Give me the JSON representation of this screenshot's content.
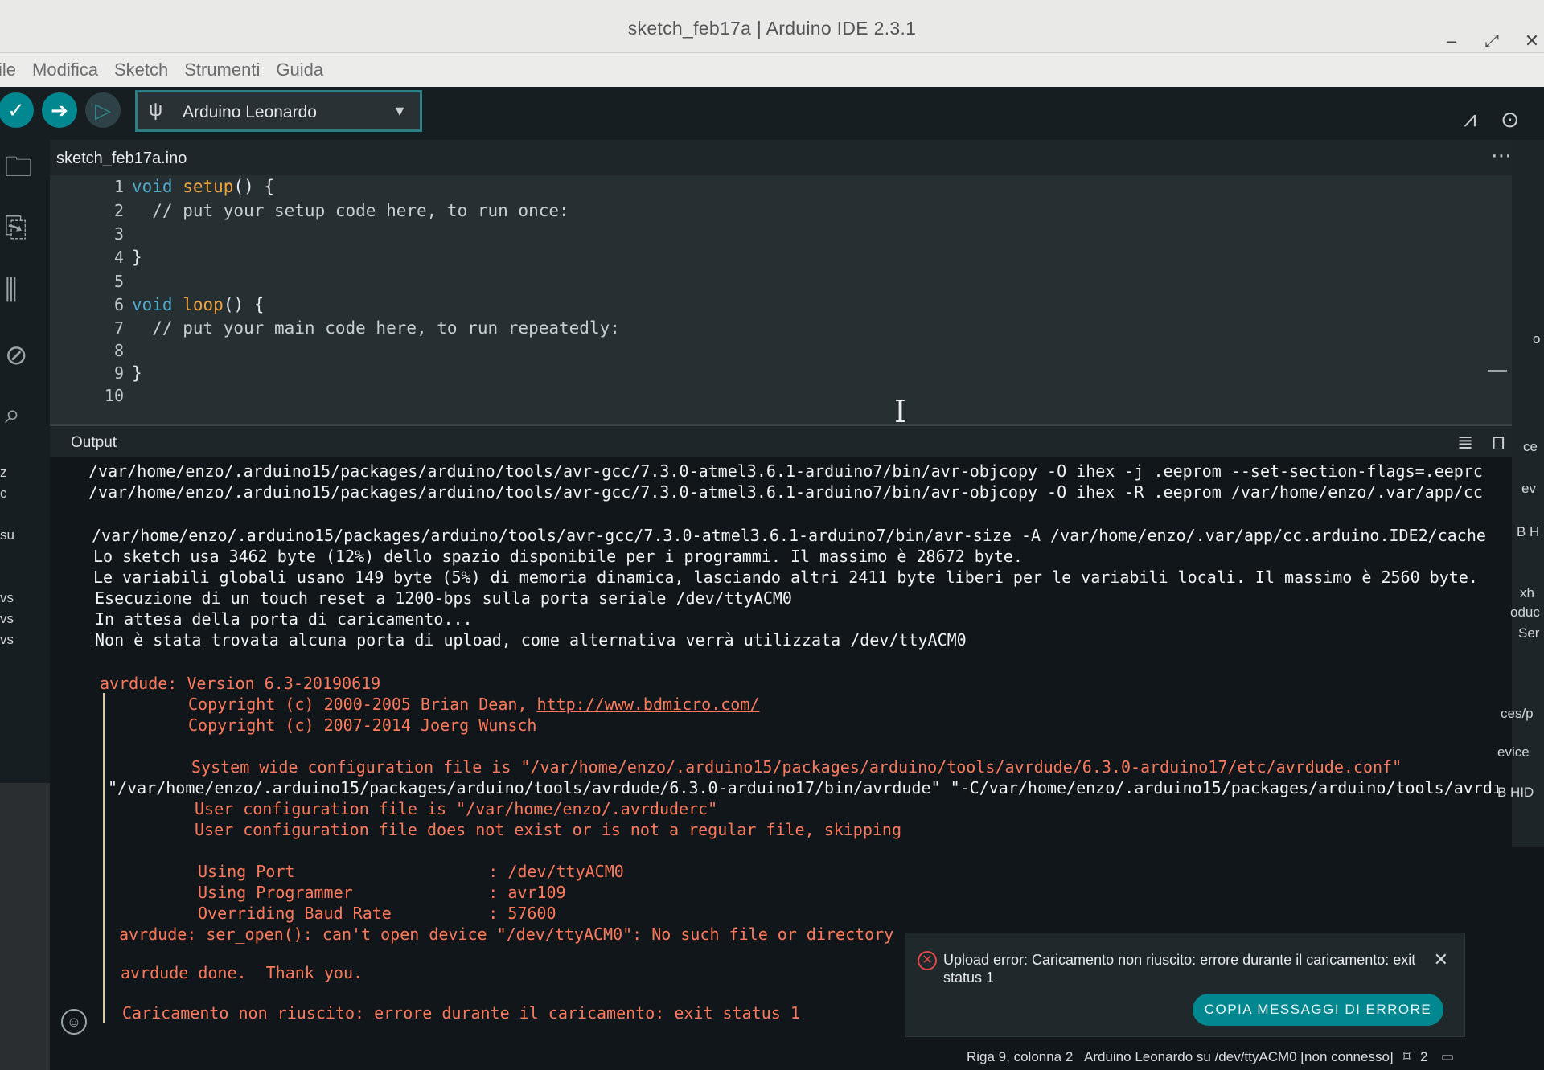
{
  "window": {
    "title": "sketch_feb17a | Arduino IDE 2.3.1",
    "controls": {
      "minimize": "–",
      "maximize": "⤢",
      "close": "✕"
    }
  },
  "menu": {
    "items": [
      "ile",
      "Modifica",
      "Sketch",
      "Strumenti",
      "Guida"
    ]
  },
  "toolbar": {
    "verify_icon": "check-icon",
    "upload_icon": "arrow-right-icon",
    "debug_icon": "debug-icon",
    "board": "Arduino Leonardo"
  },
  "editor": {
    "tab_name": "sketch_feb17a.ino",
    "line_numbers": [
      "1",
      "2",
      "3",
      "4",
      "5",
      "6",
      "7",
      "8",
      "9",
      "10"
    ],
    "lines": {
      "l1_kw": "void",
      "l1_fn": "setup",
      "l1_rest": "() {",
      "l2": "  // put your setup code here, to run once:",
      "l4": "}",
      "l6_kw": "void",
      "l6_fn": "loop",
      "l6_rest": "() {",
      "l7": "  // put your main code here, to run repeatedly:",
      "l9": "}"
    }
  },
  "output": {
    "header": "Output",
    "lines": [
      "/var/home/enzo/.arduino15/packages/arduino/tools/avr-gcc/7.3.0-atmel3.6.1-arduino7/bin/avr-objcopy -O ihex -j .eeprom --set-section-flags=.eeprc",
      "/var/home/enzo/.arduino15/packages/arduino/tools/avr-gcc/7.3.0-atmel3.6.1-arduino7/bin/avr-objcopy -O ihex -R .eeprom /var/home/enzo/.var/app/cc",
      "/var/home/enzo/.arduino15/packages/arduino/tools/avr-gcc/7.3.0-atmel3.6.1-arduino7/bin/avr-size -A /var/home/enzo/.var/app/cc.arduino.IDE2/cache",
      "Lo sketch usa 3462 byte (12%) dello spazio disponibile per i programmi. Il massimo è 28672 byte.",
      "Le variabili globali usano 149 byte (5%) di memoria dinamica, lasciando altri 2411 byte liberi per le variabili locali. Il massimo è 2560 byte.",
      "Esecuzione di un touch reset a 1200-bps sulla porta seriale /dev/ttyACM0",
      "In attesa della porta di caricamento...",
      "Non è stata trovata alcuna porta di upload, come alternativa verrà utilizzata /dev/ttyACM0"
    ],
    "avrdude": {
      "version": "avrdude: Version 6.3-20190619",
      "copy1_prefix": "Copyright (c) 2000-2005 Brian Dean, ",
      "copy1_link": "http://www.bdmicro.com/",
      "copy2": "Copyright (c) 2007-2014 Joerg Wunsch",
      "syscfg": "System wide configuration file is \"/var/home/enzo/.arduino15/packages/arduino/tools/avrdude/6.3.0-arduino17/etc/avrdude.conf\"",
      "cmd": "\"/var/home/enzo/.arduino15/packages/arduino/tools/avrdude/6.3.0-arduino17/bin/avrdude\" \"-C/var/home/enzo/.arduino15/packages/arduino/tools/avrdı",
      "usercfg": "User configuration file is \"/var/home/enzo/.avrduderc\"",
      "usercfg_missing": "User configuration file does not exist or is not a regular file, skipping",
      "port": "Using Port                    : /dev/ttyACM0",
      "programmer": "Using Programmer              : avr109",
      "baud": "Overriding Baud Rate          : 57600",
      "ser_open": "avrdude: ser_open(): can't open device \"/dev/ttyACM0\": No such file or directory",
      "done": "avrdude done.  Thank you.",
      "failed": "Caricamento non riuscito: errore durante il caricamento: exit status 1"
    }
  },
  "notification": {
    "message": "Upload error: Caricamento non riuscito: errore durante il caricamento: exit status 1",
    "button": "COPIA MESSAGGI DI ERRORE",
    "close": "✕"
  },
  "status": {
    "position": "Riga 9, colonna 2",
    "board_port": "Arduino Leonardo su /dev/ttyACM0 [non connesso]",
    "notifications": "2"
  },
  "background_fragments": {
    "right": [
      "o",
      "ce",
      "ev",
      "B H",
      "xh",
      "oduc",
      "Ser",
      "ces/p",
      "evice",
      "B HID"
    ],
    "left": [
      "z",
      "c",
      "su",
      "vs",
      "vs",
      "vs"
    ]
  },
  "colors": {
    "accent": "#00878f",
    "error_text": "#ff7a5c",
    "keyword": "#53a9c9",
    "function": "#f0a43d"
  }
}
